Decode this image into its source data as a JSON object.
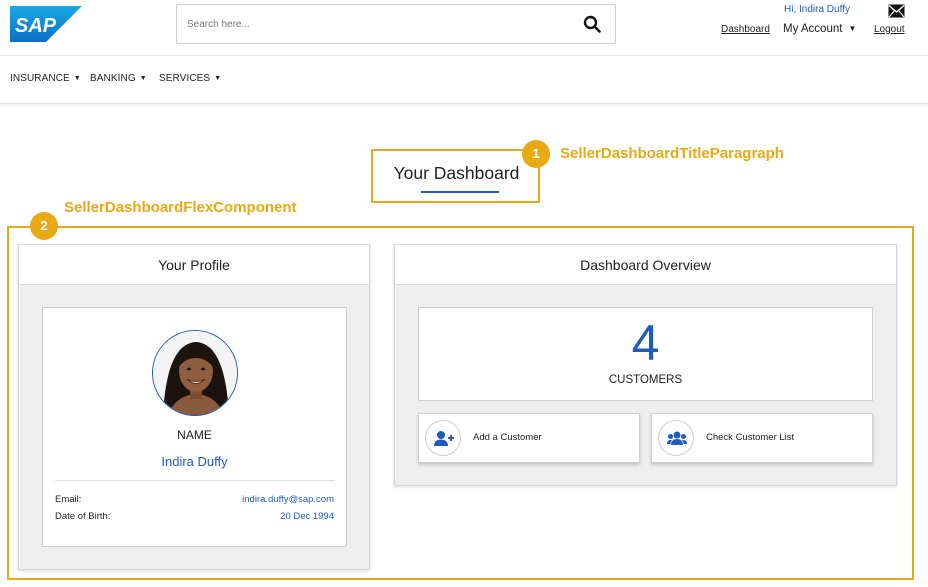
{
  "header": {
    "logo_text": "SAP",
    "search_placeholder": "Search here...",
    "greeting": "Hi, Indira Duffy",
    "dashboard_link": "Dashboard",
    "account_label": "My Account",
    "logout_link": "Logout"
  },
  "nav": {
    "items": [
      {
        "label": "INSURANCE"
      },
      {
        "label": "BANKING"
      },
      {
        "label": "SERVICES"
      }
    ]
  },
  "title": "Your Dashboard",
  "annotations": [
    {
      "number": "1",
      "label": "SellerDashboardTitleParagraph"
    },
    {
      "number": "2",
      "label": "SellerDashboardFlexComponent"
    }
  ],
  "profile": {
    "heading": "Your Profile",
    "name_label": "NAME",
    "name_value": "Indira Duffy",
    "email_label": "Email:",
    "email_value": "indira.duffy@sap.com",
    "dob_label": "Date of Birth:",
    "dob_value": "20 Dec 1994"
  },
  "overview": {
    "heading": "Dashboard Overview",
    "customer_count": "4",
    "customer_label": "CUSTOMERS",
    "add_customer_label": "Add a Customer",
    "check_list_label": "Check Customer List"
  },
  "colors": {
    "accent_blue": "#1f5bbf",
    "annotation_gold": "#e7a914"
  },
  "icons": [
    "search-icon",
    "mail-icon",
    "chevron-down-icon",
    "add-user-icon",
    "users-icon"
  ]
}
